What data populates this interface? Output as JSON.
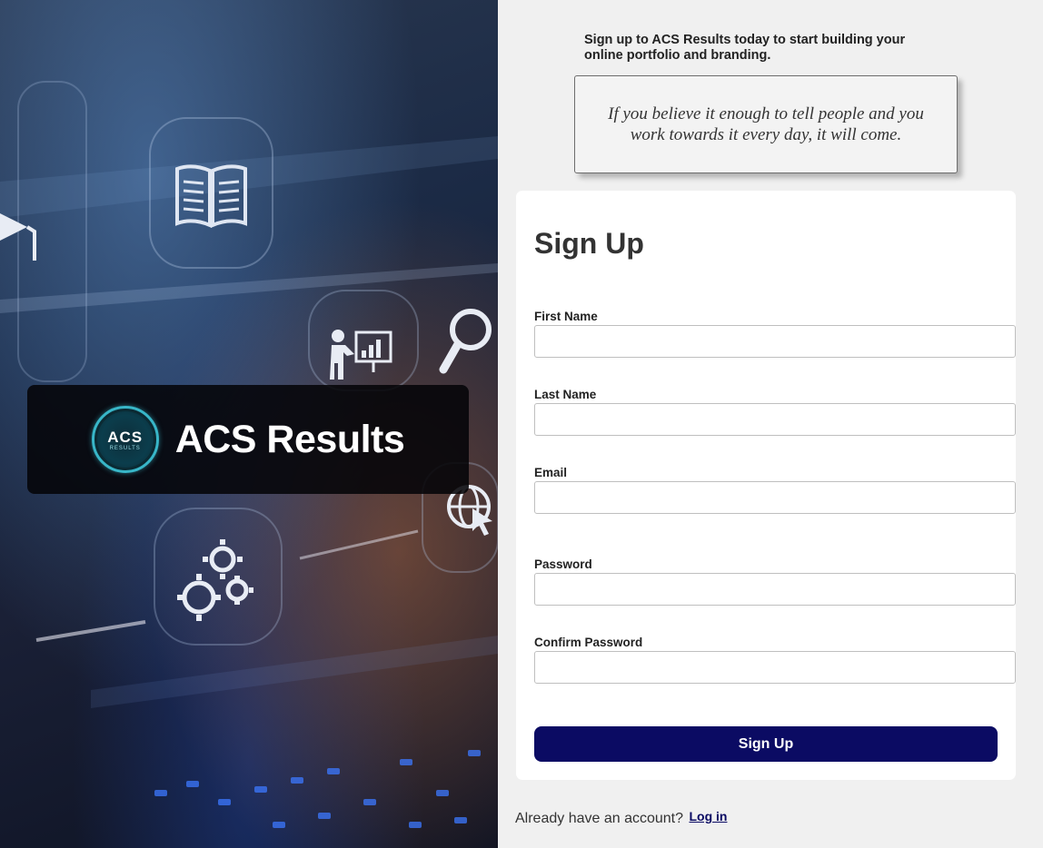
{
  "brand": {
    "name": "ACS Results",
    "logo_text": "ACS",
    "logo_subtext": "RESULTS"
  },
  "intro": {
    "text": "Sign up to ACS Results today to start building your online portfolio and branding."
  },
  "quote": {
    "text": "If you believe it enough to tell people and you work towards it every day, it will come."
  },
  "form": {
    "title": "Sign Up",
    "fields": [
      {
        "label": "First Name",
        "value": "",
        "placeholder": ""
      },
      {
        "label": "Last Name",
        "value": "",
        "placeholder": ""
      },
      {
        "label": "Email",
        "value": "",
        "placeholder": ""
      },
      {
        "label": "Password",
        "value": "",
        "placeholder": ""
      },
      {
        "label": "Confirm Password",
        "value": "",
        "placeholder": ""
      }
    ],
    "submit_label": "Sign Up"
  },
  "footer": {
    "prompt": "Already have an account?",
    "login_label": "Log in"
  },
  "colors": {
    "accent": "#0b0b63",
    "page_background": "#f0f0f0",
    "card_background": "#ffffff",
    "logo_ring": "#38b6c8"
  },
  "icons": [
    "open-book-icon",
    "presentation-icon",
    "magnifier-icon",
    "gears-icon",
    "globe-cursor-icon",
    "graduation-cap-icon"
  ]
}
